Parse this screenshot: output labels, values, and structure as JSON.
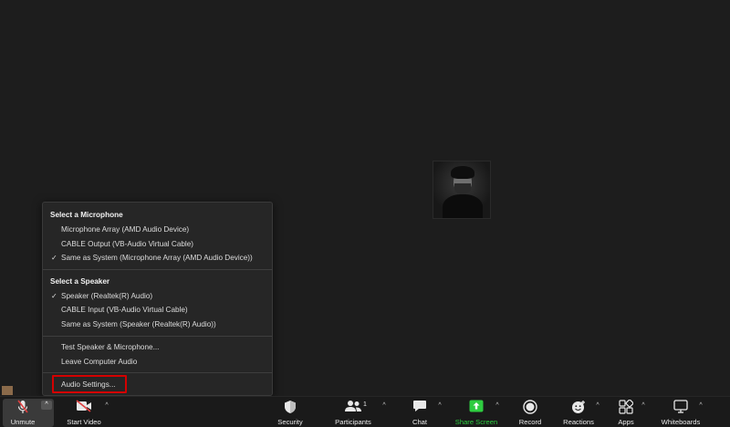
{
  "audio_menu": {
    "microphone": {
      "title": "Select a Microphone",
      "items": [
        {
          "label": "Microphone Array (AMD Audio Device)",
          "checked": false
        },
        {
          "label": "CABLE Output (VB-Audio Virtual Cable)",
          "checked": false
        },
        {
          "label": "Same as System (Microphone Array (AMD Audio Device))",
          "checked": true
        }
      ]
    },
    "speaker": {
      "title": "Select a Speaker",
      "items": [
        {
          "label": "Speaker (Realtek(R) Audio)",
          "checked": true
        },
        {
          "label": "CABLE Input (VB-Audio Virtual Cable)",
          "checked": false
        },
        {
          "label": "Same as System (Speaker (Realtek(R) Audio))",
          "checked": false
        }
      ]
    },
    "check_mark": "✓",
    "test_label": "Test Speaker & Microphone...",
    "leave_label": "Leave Computer Audio",
    "settings_label": "Audio Settings..."
  },
  "toolbar": {
    "unmute": "Unmute",
    "start_video": "Start Video",
    "security": "Security",
    "participants": "Participants",
    "participants_count": "1",
    "chat": "Chat",
    "share_screen": "Share Screen",
    "record": "Record",
    "reactions": "Reactions",
    "apps": "Apps",
    "whiteboards": "Whiteboards",
    "caret": "^"
  },
  "colors": {
    "highlight": "#d40000",
    "share_green": "#2ecc40"
  }
}
